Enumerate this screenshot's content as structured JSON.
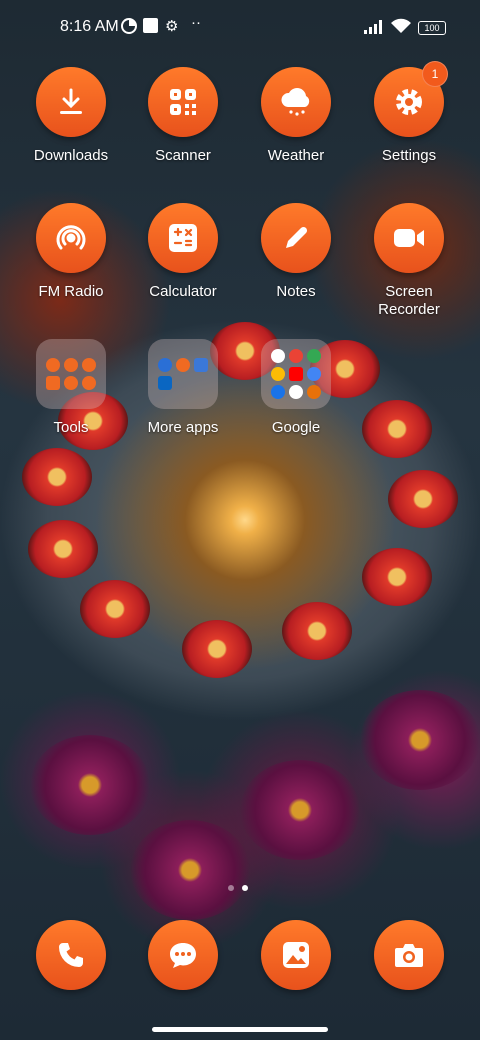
{
  "status_bar": {
    "time": "8:16 AM",
    "battery": "100",
    "left_icons": [
      "data-saver-icon",
      "square-notification-icon",
      "gear-icon",
      "more-dots-icon"
    ],
    "right_icons": [
      "signal-icon",
      "wifi-icon",
      "battery-icon"
    ]
  },
  "apps_row1": [
    {
      "label": "Downloads",
      "icon": "download-icon"
    },
    {
      "label": "Scanner",
      "icon": "scanner-icon"
    },
    {
      "label": "Weather",
      "icon": "weather-icon"
    },
    {
      "label": "Settings",
      "icon": "gear-icon",
      "badge": "1"
    }
  ],
  "apps_row2": [
    {
      "label": "FM Radio",
      "icon": "radio-icon"
    },
    {
      "label": "Calculator",
      "icon": "calculator-icon"
    },
    {
      "label": "Notes",
      "icon": "pencil-icon"
    },
    {
      "label": "Screen\nRecorder",
      "icon": "video-camera-icon"
    }
  ],
  "folders": [
    {
      "label": "Tools"
    },
    {
      "label": "More apps"
    },
    {
      "label": "Google"
    }
  ],
  "page_indicator": {
    "pages": 2,
    "current": 2
  },
  "dock": [
    {
      "name": "phone",
      "icon": "phone-icon"
    },
    {
      "name": "messages",
      "icon": "chat-icon"
    },
    {
      "name": "gallery",
      "icon": "gallery-icon"
    },
    {
      "name": "camera",
      "icon": "camera-icon"
    }
  ],
  "colors": {
    "accent": "#f0621f",
    "badge": "#f25a1c"
  }
}
